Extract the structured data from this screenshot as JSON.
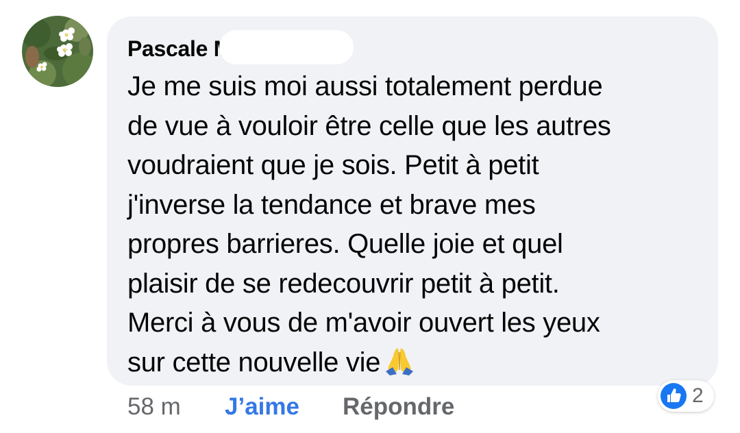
{
  "comment": {
    "author": "Pascale M...",
    "lines": [
      "Je me suis moi aussi totalement perdue",
      "de vue à vouloir être celle que les autres",
      "voudraient que je sois. Petit à petit",
      "j'inverse la tendance et brave mes",
      "propres barrieres. Quelle joie et quel",
      "plaisir de se redecouvrir petit à petit.",
      "Merci à vous de m'avoir ouvert les yeux",
      "sur cette nouvelle vie"
    ],
    "emoji": "folded-hands-emoji"
  },
  "meta": {
    "time": "58 m",
    "like_label": "J’aime",
    "reply_label": "Répondre"
  },
  "reactions": {
    "icon": "like-thumb-icon",
    "count": "2",
    "color": "#1877f2"
  },
  "colors": {
    "bubble": "#f0f2f5",
    "link": "#3578e5",
    "muted": "#65676b",
    "text": "#050505"
  }
}
